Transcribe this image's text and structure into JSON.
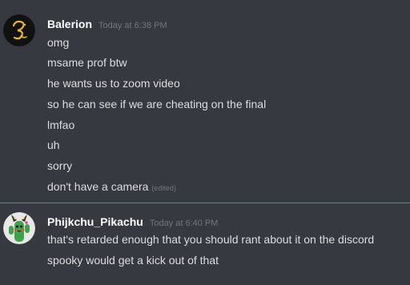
{
  "messages": [
    {
      "username": "Balerion",
      "timestamp": "Today at 6:38 PM",
      "lines": [
        "omg",
        "msame prof btw",
        "he wants us to zoom video",
        "so he can see if we are cheating on the final",
        "lmfao",
        "uh",
        "sorry",
        "don't have a camera"
      ],
      "edited_label": "(edited)"
    },
    {
      "username": "Phijkchu_Pikachu",
      "timestamp": "Today at 6:40 PM",
      "lines": [
        "that's retarded enough that you should rant about it on the discord",
        "spooky would get a kick out of that"
      ]
    }
  ],
  "colors": {
    "background": "#36393f",
    "username": "#ffffff",
    "timestamp": "#72767d",
    "message_text": "#dcddde",
    "new_messages_divider": "#f04747"
  }
}
